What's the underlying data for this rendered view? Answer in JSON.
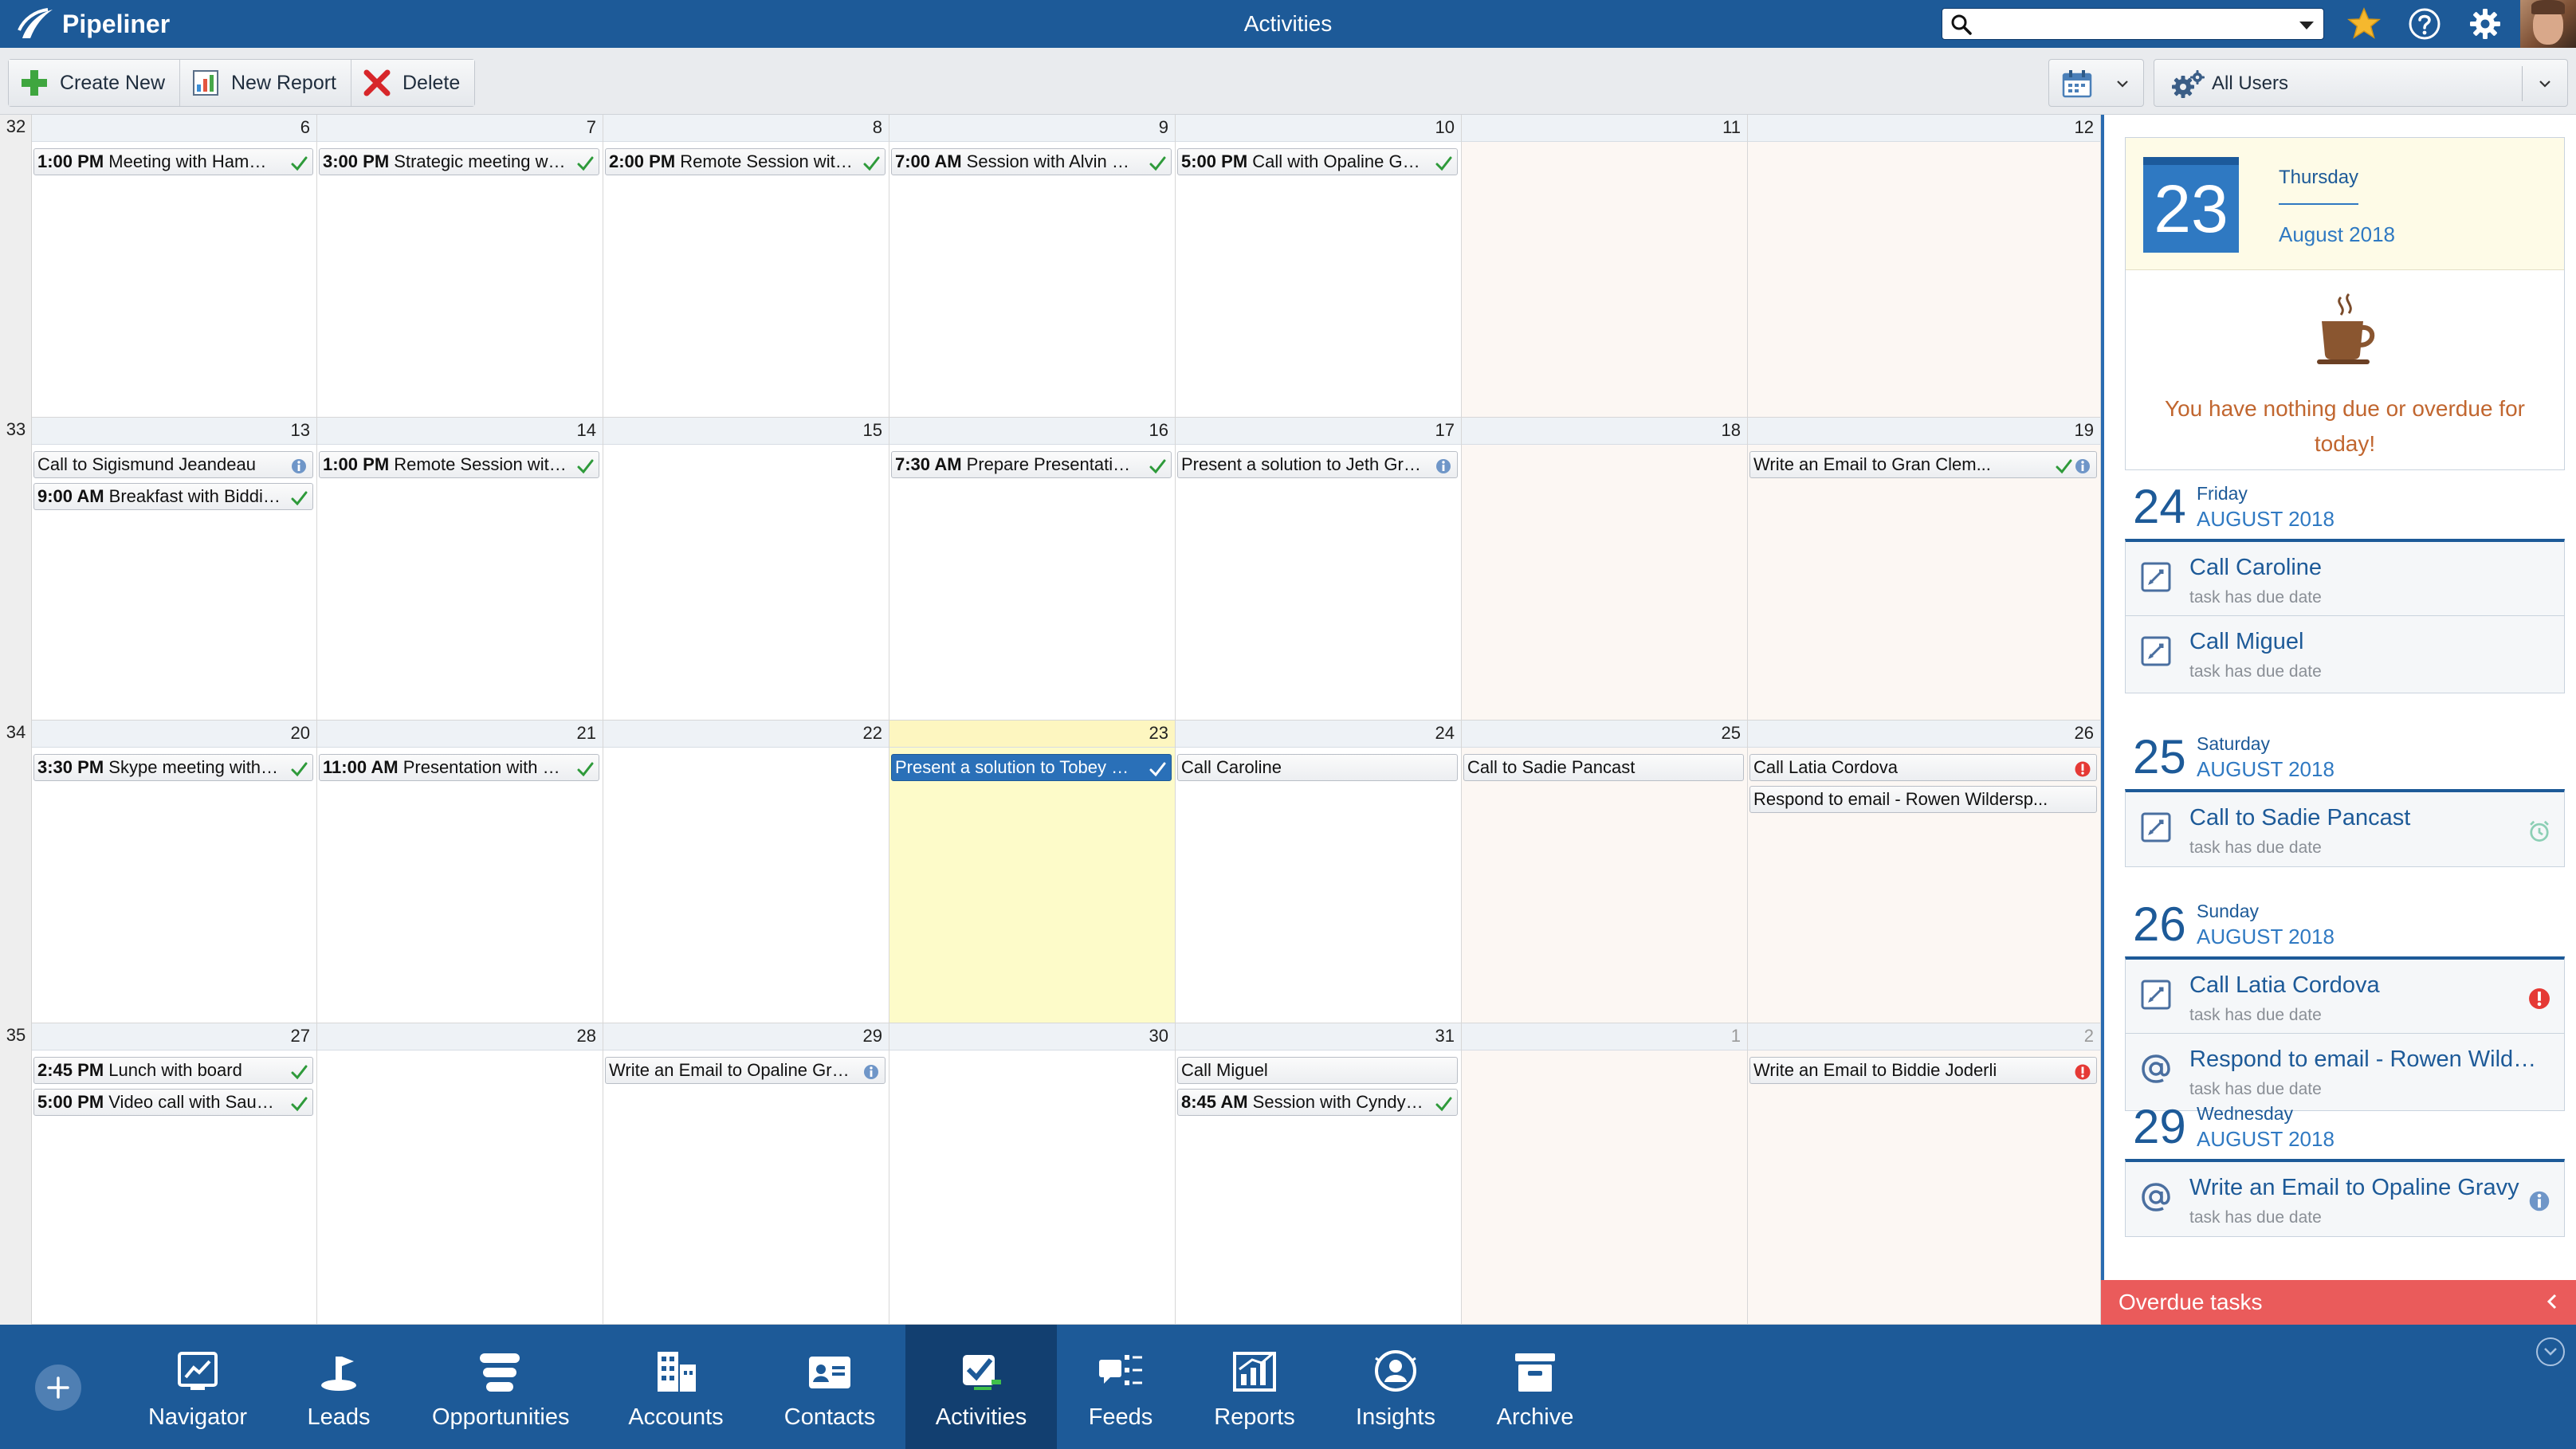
{
  "app": {
    "brand": "Pipeliner",
    "title": "Activities",
    "search": {
      "value": "",
      "placeholder": ""
    }
  },
  "toolbar": {
    "create_new": "Create New",
    "new_report": "New Report",
    "delete": "Delete",
    "users_filter": "All Users"
  },
  "calendar": {
    "weeks": [
      {
        "week": "32",
        "days": [
          {
            "num": "6",
            "events": [
              {
                "time": "1:00 PM",
                "text": "Meeting with Hammad ...",
                "status": "check"
              }
            ]
          },
          {
            "num": "7",
            "events": [
              {
                "time": "3:00 PM",
                "text": "Strategic meeting with ...",
                "status": "check"
              }
            ]
          },
          {
            "num": "8",
            "events": [
              {
                "time": "2:00 PM",
                "text": "Remote Session with S...",
                "status": "check"
              }
            ]
          },
          {
            "num": "9",
            "events": [
              {
                "time": "7:00 AM",
                "text": "Session with Alvin Cree...",
                "status": "check"
              }
            ]
          },
          {
            "num": "10",
            "events": [
              {
                "time": "5:00 PM",
                "text": "Call with Opaline Gravy",
                "status": "check"
              }
            ]
          },
          {
            "num": "11",
            "weekend": true,
            "events": []
          },
          {
            "num": "12",
            "weekend": true,
            "events": []
          }
        ]
      },
      {
        "week": "33",
        "days": [
          {
            "num": "13",
            "events": [
              {
                "time": "",
                "text": "Call to Sigismund Jeandeau",
                "status": "info"
              },
              {
                "time": "9:00 AM",
                "text": "Breakfast with Biddie J...",
                "status": "check"
              }
            ]
          },
          {
            "num": "14",
            "events": [
              {
                "time": "1:00 PM",
                "text": "Remote Session with T...",
                "status": "check"
              }
            ]
          },
          {
            "num": "15",
            "events": []
          },
          {
            "num": "16",
            "events": [
              {
                "time": "7:30 AM",
                "text": "Prepare Presentation f...",
                "status": "check"
              }
            ]
          },
          {
            "num": "17",
            "events": [
              {
                "time": "",
                "text": "Present a solution to Jeth Green...",
                "status": "info"
              }
            ]
          },
          {
            "num": "18",
            "weekend": true,
            "events": []
          },
          {
            "num": "19",
            "weekend": true,
            "events": [
              {
                "time": "",
                "text": "Write an Email to Gran Clem...",
                "status": "check-info"
              }
            ]
          }
        ]
      },
      {
        "week": "34",
        "days": [
          {
            "num": "20",
            "events": [
              {
                "time": "3:30 PM",
                "text": "Skype meeting with An...",
                "status": "check"
              }
            ]
          },
          {
            "num": "21",
            "events": [
              {
                "time": "11:00 AM",
                "text": "Presentation with Gra...",
                "status": "check"
              }
            ]
          },
          {
            "num": "22",
            "events": []
          },
          {
            "num": "23",
            "today": true,
            "events": [
              {
                "time": "",
                "text": "Present a solution to Tobey Bodl...",
                "status": "check",
                "selected": true
              }
            ]
          },
          {
            "num": "24",
            "events": [
              {
                "time": "",
                "text": "Call Caroline",
                "status": ""
              }
            ]
          },
          {
            "num": "25",
            "weekend": true,
            "events": [
              {
                "time": "",
                "text": "Call to Sadie Pancast",
                "status": ""
              }
            ]
          },
          {
            "num": "26",
            "weekend": true,
            "events": [
              {
                "time": "",
                "text": "Call Latia Cordova",
                "status": "alert"
              },
              {
                "time": "",
                "text": "Respond to email - Rowen Wildersp...",
                "status": ""
              }
            ]
          }
        ]
      },
      {
        "week": "35",
        "days": [
          {
            "num": "27",
            "events": [
              {
                "time": "2:45 PM",
                "text": "Lunch with board",
                "status": "check"
              },
              {
                "time": "5:00 PM",
                "text": "Video call with Saunder...",
                "status": "check"
              }
            ]
          },
          {
            "num": "28",
            "events": []
          },
          {
            "num": "29",
            "events": [
              {
                "time": "",
                "text": "Write an Email to Opaline Gravy",
                "status": "info"
              }
            ]
          },
          {
            "num": "30",
            "events": []
          },
          {
            "num": "31",
            "events": [
              {
                "time": "",
                "text": "Call Miguel",
                "status": ""
              },
              {
                "time": "8:45 AM",
                "text": "Session with Cyndy Wa...",
                "status": "check"
              }
            ]
          },
          {
            "num": "1",
            "weekend": true,
            "muted": true,
            "events": []
          },
          {
            "num": "2",
            "weekend": true,
            "muted": true,
            "events": [
              {
                "time": "",
                "text": "Write an Email to Biddie Joderli",
                "status": "alert"
              }
            ]
          }
        ]
      }
    ]
  },
  "panel": {
    "today": {
      "day": "23",
      "weekday": "Thursday",
      "month": "August 2018",
      "message": "You have nothing due or overdue for today!"
    },
    "groups": [
      {
        "day": "24",
        "weekday": "Friday",
        "month": "AUGUST 2018",
        "tasks": [
          {
            "icon": "task-icon",
            "title": "Call Caroline",
            "sub": "task has due date",
            "flag": ""
          },
          {
            "icon": "task-icon",
            "title": "Call Miguel",
            "sub": "task has due date",
            "flag": ""
          }
        ]
      },
      {
        "day": "25",
        "weekday": "Saturday",
        "month": "AUGUST 2018",
        "tasks": [
          {
            "icon": "task-icon",
            "title": "Call to Sadie Pancast",
            "sub": "task has due date",
            "flag": "alarm"
          }
        ]
      },
      {
        "day": "26",
        "weekday": "Sunday",
        "month": "AUGUST 2018",
        "tasks": [
          {
            "icon": "task-icon",
            "title": "Call Latia Cordova",
            "sub": "task has due date",
            "flag": "alert"
          },
          {
            "icon": "email-icon",
            "title": "Respond to email - Rowen Wilders...",
            "sub": "task has due date",
            "flag": ""
          }
        ]
      },
      {
        "day": "29",
        "weekday": "Wednesday",
        "month": "AUGUST 2018",
        "tasks": [
          {
            "icon": "email-icon",
            "title": "Write an Email to Opaline Gravy",
            "sub": "task has due date",
            "flag": "info"
          }
        ]
      }
    ],
    "overdue": "Overdue tasks"
  },
  "nav": {
    "items": [
      {
        "key": "navigator",
        "label": "Navigator"
      },
      {
        "key": "leads",
        "label": "Leads"
      },
      {
        "key": "opportunities",
        "label": "Opportunities"
      },
      {
        "key": "accounts",
        "label": "Accounts"
      },
      {
        "key": "contacts",
        "label": "Contacts"
      },
      {
        "key": "activities",
        "label": "Activities",
        "active": true
      },
      {
        "key": "feeds",
        "label": "Feeds"
      },
      {
        "key": "reports",
        "label": "Reports"
      },
      {
        "key": "insights",
        "label": "Insights"
      },
      {
        "key": "archive",
        "label": "Archive"
      }
    ]
  },
  "colors": {
    "brand": "#1d5a98",
    "today": "#fdfbc9",
    "weekend": "#fcf7f3",
    "accent_orange": "#c1662f",
    "overdue": "#ea5b5b",
    "check_green": "#2e9a3a",
    "alert_red": "#e53935",
    "info_blue": "#6f96c8"
  }
}
